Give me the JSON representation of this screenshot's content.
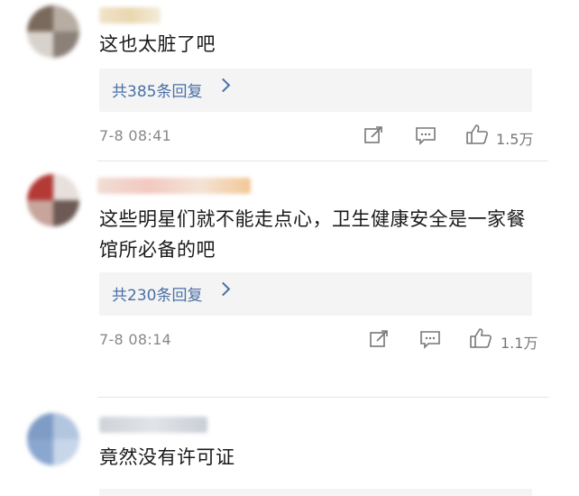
{
  "comments": [
    {
      "text": "这也太脏了吧",
      "replies_label": "共385条回复",
      "time": "7-8 08:41",
      "likes": "1.5万"
    },
    {
      "text": "这些明星们就不能走点心，卫生健康安全是一家餐馆所必备的吧",
      "replies_label": "共230条回复",
      "time": "7-8 08:14",
      "likes": "1.1万"
    },
    {
      "text": "竟然没有许可证"
    }
  ],
  "colors": {
    "link": "#4a6fa5",
    "meta": "#888888",
    "reply_bg": "#f4f4f4"
  },
  "icons": [
    "share-icon",
    "comment-icon",
    "thumbs-up-icon"
  ]
}
